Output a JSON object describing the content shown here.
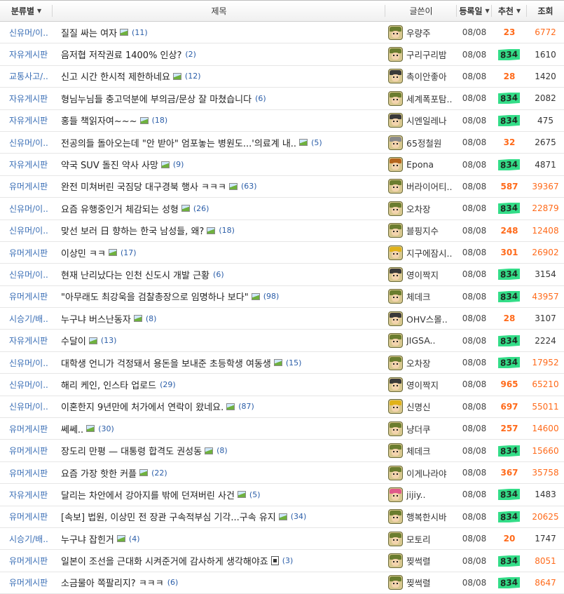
{
  "header": {
    "category": "분류별",
    "title": "제목",
    "writer": "글쓴이",
    "date": "등록일",
    "recommend": "추천",
    "views": "조회"
  },
  "colors": {
    "category_link": "#3b6fb6",
    "hot_orange": "#ff6a1a",
    "highlight_green": "#33dd88",
    "comment_blue": "#2a5da8"
  },
  "rows": [
    {
      "category": "신유머/이..",
      "title": "질질 싸는 여자",
      "icon": "image-icon",
      "comments": "(11)",
      "writer": "우량주",
      "avatar": "green",
      "date": "08/08",
      "recommend": "23",
      "rec_hl": false,
      "views": "6772",
      "views_hot": true
    },
    {
      "category": "자유게시판",
      "title": "음저협 저작권료 1400% 인상?",
      "icon": "none",
      "comments": "(2)",
      "writer": "구리구리밤",
      "avatar": "green",
      "date": "08/08",
      "recommend": "834",
      "rec_hl": true,
      "views": "1610",
      "views_hot": false
    },
    {
      "category": "교통사고/..",
      "title": "신고 시간 한시적 제한하네요",
      "icon": "image-icon",
      "comments": "(12)",
      "writer": "촉이안좋아",
      "avatar": "dark",
      "date": "08/08",
      "recommend": "28",
      "rec_hl": false,
      "views": "1420",
      "views_hot": false
    },
    {
      "category": "자유게시판",
      "title": "형님누님들 충고덕분에 부의금/문상 잘 마쳤습니다",
      "icon": "none",
      "comments": "(6)",
      "writer": "세계폭포탐..",
      "avatar": "green",
      "date": "08/08",
      "recommend": "834",
      "rec_hl": true,
      "views": "2082",
      "views_hot": false
    },
    {
      "category": "자유게시판",
      "title": "홍들 책읽자여~~~",
      "icon": "image-icon",
      "comments": "(18)",
      "writer": "시엔일레나",
      "avatar": "dark",
      "date": "08/08",
      "recommend": "834",
      "rec_hl": true,
      "views": "475",
      "views_hot": false
    },
    {
      "category": "신유머/이..",
      "title": "전공의들 돌아오는데 \"안 받아\" 엄포놓는 병원도...'의료계 내..",
      "icon": "image-icon",
      "comments": "(5)",
      "writer": "65정철원",
      "avatar": "gray",
      "date": "08/08",
      "recommend": "32",
      "rec_hl": false,
      "views": "2675",
      "views_hot": false
    },
    {
      "category": "자유게시판",
      "title": "약국 SUV 돌진 약사 사망",
      "icon": "image-icon",
      "comments": "(9)",
      "writer": "Epona",
      "avatar": "brown",
      "date": "08/08",
      "recommend": "834",
      "rec_hl": true,
      "views": "4871",
      "views_hot": false
    },
    {
      "category": "유머게시판",
      "title": "완전 미쳐버린 국짐당 대구경북 행사 ㅋㅋㅋ",
      "icon": "image-icon",
      "comments": "(63)",
      "writer": "버라이어티..",
      "avatar": "green",
      "date": "08/08",
      "recommend": "587",
      "rec_hl": false,
      "views": "39367",
      "views_hot": true
    },
    {
      "category": "신유머/이..",
      "title": "요즘 유행중인거 체감되는 성형",
      "icon": "image-icon",
      "comments": "(26)",
      "writer": "오차장",
      "avatar": "green",
      "date": "08/08",
      "recommend": "834",
      "rec_hl": true,
      "views": "22879",
      "views_hot": true
    },
    {
      "category": "신유머/이..",
      "title": "맞선 보러 日 향하는 한국 남성들, 왜?",
      "icon": "image-icon",
      "comments": "(18)",
      "writer": "블핑지수",
      "avatar": "green",
      "date": "08/08",
      "recommend": "248",
      "rec_hl": false,
      "views": "12408",
      "views_hot": true
    },
    {
      "category": "유머게시판",
      "title": "이상민 ㅋㅋ",
      "icon": "image-icon",
      "comments": "(17)",
      "writer": "지구에잠시..",
      "avatar": "yellow",
      "date": "08/08",
      "recommend": "301",
      "rec_hl": false,
      "views": "26902",
      "views_hot": true
    },
    {
      "category": "신유머/이..",
      "title": "현재 난리났다는 인천 신도시 개발 근황",
      "icon": "none",
      "comments": "(6)",
      "writer": "영이짝지",
      "avatar": "dark",
      "date": "08/08",
      "recommend": "834",
      "rec_hl": true,
      "views": "3154",
      "views_hot": false
    },
    {
      "category": "유머게시판",
      "title": "\"아무래도 최강욱을 검찰총장으로 임명하나 보다\"",
      "icon": "image-icon",
      "comments": "(98)",
      "writer": "체데크",
      "avatar": "green",
      "date": "08/08",
      "recommend": "834",
      "rec_hl": true,
      "views": "43957",
      "views_hot": true
    },
    {
      "category": "시승기/배..",
      "title": "누구냐 버스난동자",
      "icon": "image-icon",
      "comments": "(8)",
      "writer": "OHV스몰..",
      "avatar": "dark",
      "date": "08/08",
      "recommend": "28",
      "rec_hl": false,
      "views": "3107",
      "views_hot": false
    },
    {
      "category": "자유게시판",
      "title": "수달이",
      "icon": "image-icon",
      "comments": "(13)",
      "writer": "JIGSA..",
      "avatar": "green",
      "date": "08/08",
      "recommend": "834",
      "rec_hl": true,
      "views": "2224",
      "views_hot": false
    },
    {
      "category": "신유머/이..",
      "title": "대학생 언니가 걱정돼서 용돈을 보내준 초등학생 여동생",
      "icon": "image-icon",
      "comments": "(15)",
      "writer": "오차장",
      "avatar": "green",
      "date": "08/08",
      "recommend": "834",
      "rec_hl": true,
      "views": "17952",
      "views_hot": true
    },
    {
      "category": "신유머/이..",
      "title": "해리 케인, 인스타 업로드",
      "icon": "none",
      "comments": "(29)",
      "writer": "영이짝지",
      "avatar": "dark",
      "date": "08/08",
      "recommend": "965",
      "rec_hl": false,
      "views": "65210",
      "views_hot": true
    },
    {
      "category": "신유머/이..",
      "title": "이혼한지 9년만에 처가에서 연락이 왔네요.",
      "icon": "image-icon",
      "comments": "(87)",
      "writer": "신명신",
      "avatar": "yellow",
      "date": "08/08",
      "recommend": "697",
      "rec_hl": false,
      "views": "55011",
      "views_hot": true
    },
    {
      "category": "유머게시판",
      "title": "쎄쎄..",
      "icon": "image-icon",
      "comments": "(30)",
      "writer": "냥더쿠",
      "avatar": "green",
      "date": "08/08",
      "recommend": "257",
      "rec_hl": false,
      "views": "14600",
      "views_hot": true
    },
    {
      "category": "유머게시판",
      "title": "장도리 만평 — 대통령 합격도 권성동",
      "icon": "image-icon",
      "comments": "(8)",
      "writer": "체데크",
      "avatar": "green",
      "date": "08/08",
      "recommend": "834",
      "rec_hl": true,
      "views": "15660",
      "views_hot": true
    },
    {
      "category": "유머게시판",
      "title": "요즘 가장 핫한 커플",
      "icon": "image-icon",
      "comments": "(22)",
      "writer": "이게나라야",
      "avatar": "green",
      "date": "08/08",
      "recommend": "367",
      "rec_hl": false,
      "views": "35758",
      "views_hot": true
    },
    {
      "category": "자유게시판",
      "title": "달리는 차안에서 강아지를 밖에 던져버린 사건",
      "icon": "image-icon",
      "comments": "(5)",
      "writer": "jijiy..",
      "avatar": "pink",
      "date": "08/08",
      "recommend": "834",
      "rec_hl": true,
      "views": "1483",
      "views_hot": false
    },
    {
      "category": "유머게시판",
      "title": "[속보] 법원, 이상민 전 장관 구속적부심 기각...구속 유지",
      "icon": "image-icon",
      "comments": "(34)",
      "writer": "행복한시바",
      "avatar": "green",
      "date": "08/08",
      "recommend": "834",
      "rec_hl": true,
      "views": "20625",
      "views_hot": true
    },
    {
      "category": "시승기/배..",
      "title": "누구냐 잡힌거",
      "icon": "image-icon",
      "comments": "(4)",
      "writer": "모토리",
      "avatar": "green",
      "date": "08/08",
      "recommend": "20",
      "rec_hl": false,
      "views": "1747",
      "views_hot": false
    },
    {
      "category": "유머게시판",
      "title": "일본이 조선을 근대화 시켜준거에 감사하게 생각해야죠",
      "icon": "doc-icon",
      "comments": "(3)",
      "writer": "찢썩렬",
      "avatar": "green",
      "date": "08/08",
      "recommend": "834",
      "rec_hl": true,
      "views": "8051",
      "views_hot": true
    },
    {
      "category": "유머게시판",
      "title": "소금물아 쪽팔리지? ㅋㅋㅋ",
      "icon": "none",
      "comments": "(6)",
      "writer": "찢썩렬",
      "avatar": "green",
      "date": "08/08",
      "recommend": "834",
      "rec_hl": true,
      "views": "8647",
      "views_hot": true
    }
  ]
}
